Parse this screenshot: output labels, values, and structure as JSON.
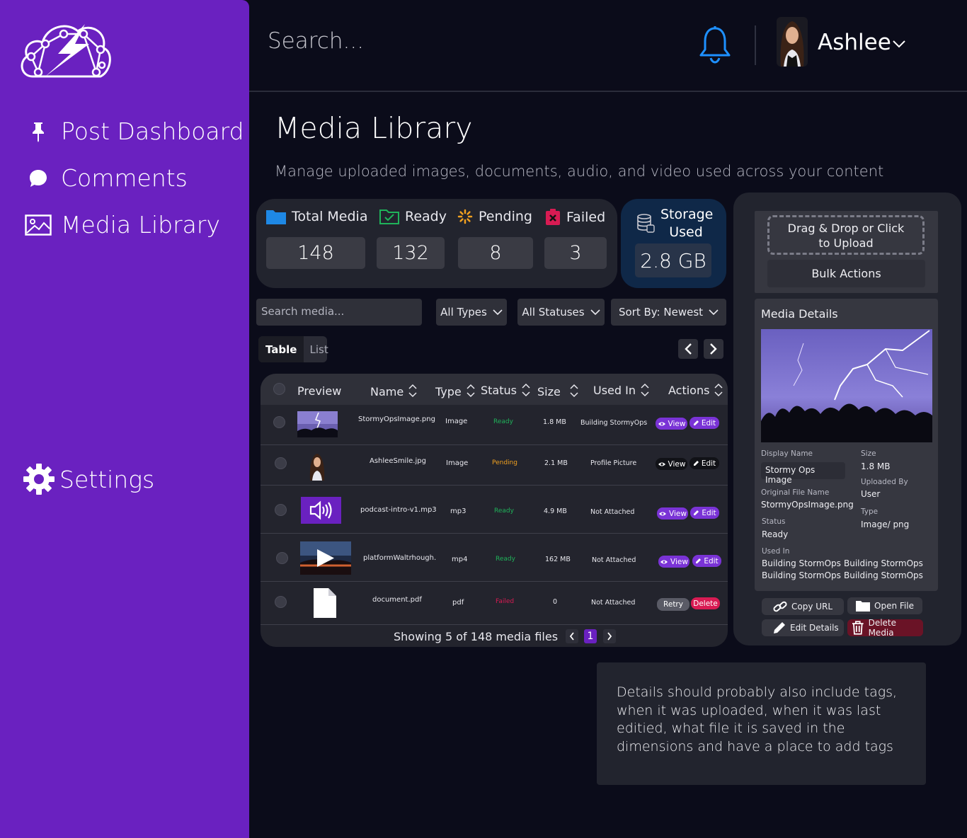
{
  "sidebar": {
    "items": [
      {
        "label": "Post Dashboard",
        "icon": "pin-icon"
      },
      {
        "label": "Comments",
        "icon": "comment-icon"
      },
      {
        "label": "Media Library",
        "icon": "image-icon"
      }
    ],
    "settings_label": "Settings"
  },
  "header": {
    "search_placeholder": "Search...",
    "user_name": "Ashlee"
  },
  "page": {
    "title": "Media Library",
    "subtitle": "Manage uploaded images, documents, audio, and video used across your content"
  },
  "stats": {
    "total": {
      "label": "Total Media",
      "value": "148"
    },
    "ready": {
      "label": "Ready",
      "value": "132"
    },
    "pending": {
      "label": "Pending",
      "value": "8"
    },
    "failed": {
      "label": "Failed",
      "value": "3"
    },
    "storage": {
      "label_line1": "Storage",
      "label_line2": "Used",
      "value": "2.8 GB"
    }
  },
  "filters": {
    "search_placeholder": "Search media...",
    "types": "All Types",
    "statuses": "All Statuses",
    "sort": "Sort By: Newest"
  },
  "view_toggle": {
    "table": "Table",
    "list": "List"
  },
  "table": {
    "headers": [
      "Preview",
      "Name",
      "Type",
      "Status",
      "Size",
      "Used In",
      "Actions"
    ],
    "rows": [
      {
        "name": "StormyOpsImage.png",
        "type": "Image",
        "status": "Ready",
        "size": "1.8 MB",
        "used_in": "Building StormyOps",
        "a1": "View",
        "a2": "Edit"
      },
      {
        "name": "AshleeSmile.jpg",
        "type": "Image",
        "status": "Pending",
        "size": "2.1 MB",
        "used_in": "Profile Picture",
        "a1": "View",
        "a2": "Edit"
      },
      {
        "name": "podcast-intro-v1.mp3",
        "type": "mp3",
        "status": "Ready",
        "size": "4.9 MB",
        "used_in": "Not Attached",
        "a1": "View",
        "a2": "Edit"
      },
      {
        "name": "platformWaltrhough.",
        "type": "mp4",
        "status": "Ready",
        "size": "162 MB",
        "used_in": "Not Attached",
        "a1": "View",
        "a2": "Edit"
      },
      {
        "name": "document.pdf",
        "type": "pdf",
        "status": "Failed",
        "size": "0",
        "used_in": "Not Attached",
        "a1": "Retry",
        "a2": "Delete"
      }
    ],
    "footer": "Showing 5 of 148 media files",
    "page": "1"
  },
  "status_colors": {
    "ready": "#1fb35a",
    "pending": "#f0a020",
    "failed": "#d81b53"
  },
  "upload": {
    "dropzone_line1": "Drag & Drop or Click",
    "dropzone_line2": "to Upload",
    "bulk_actions": "Bulk Actions"
  },
  "details": {
    "title": "Media Details",
    "display_name_label": "Display Name",
    "display_name": "Stormy Ops Image",
    "size_label": "Size",
    "size": "1.8 MB",
    "uploaded_by_label": "Uploaded By",
    "uploaded_by": "User",
    "original_file_label": "Original File Name",
    "original_file": "StormyOpsImage.png",
    "type_label": "Type",
    "type": "Image/ png",
    "status_label": "Status",
    "status": "Ready",
    "used_in_label": "Used In",
    "used_in": [
      "Building StormOps",
      "Building StormOps",
      "Building StormOps",
      "Building StormOps"
    ],
    "copy_url": "Copy URL",
    "open_file": "Open File",
    "edit_details": "Edit Details",
    "delete_media": "Delete Media"
  },
  "note": "Details should probably also include tags, when it was uploaded, when it was last editied, what file it is saved in the dimensions and have a place to add tags",
  "colors": {
    "sidebar": "#6a21c0",
    "accent": "#7a33d6",
    "background": "#0b0c1a",
    "storage_card": "#0f2848"
  }
}
